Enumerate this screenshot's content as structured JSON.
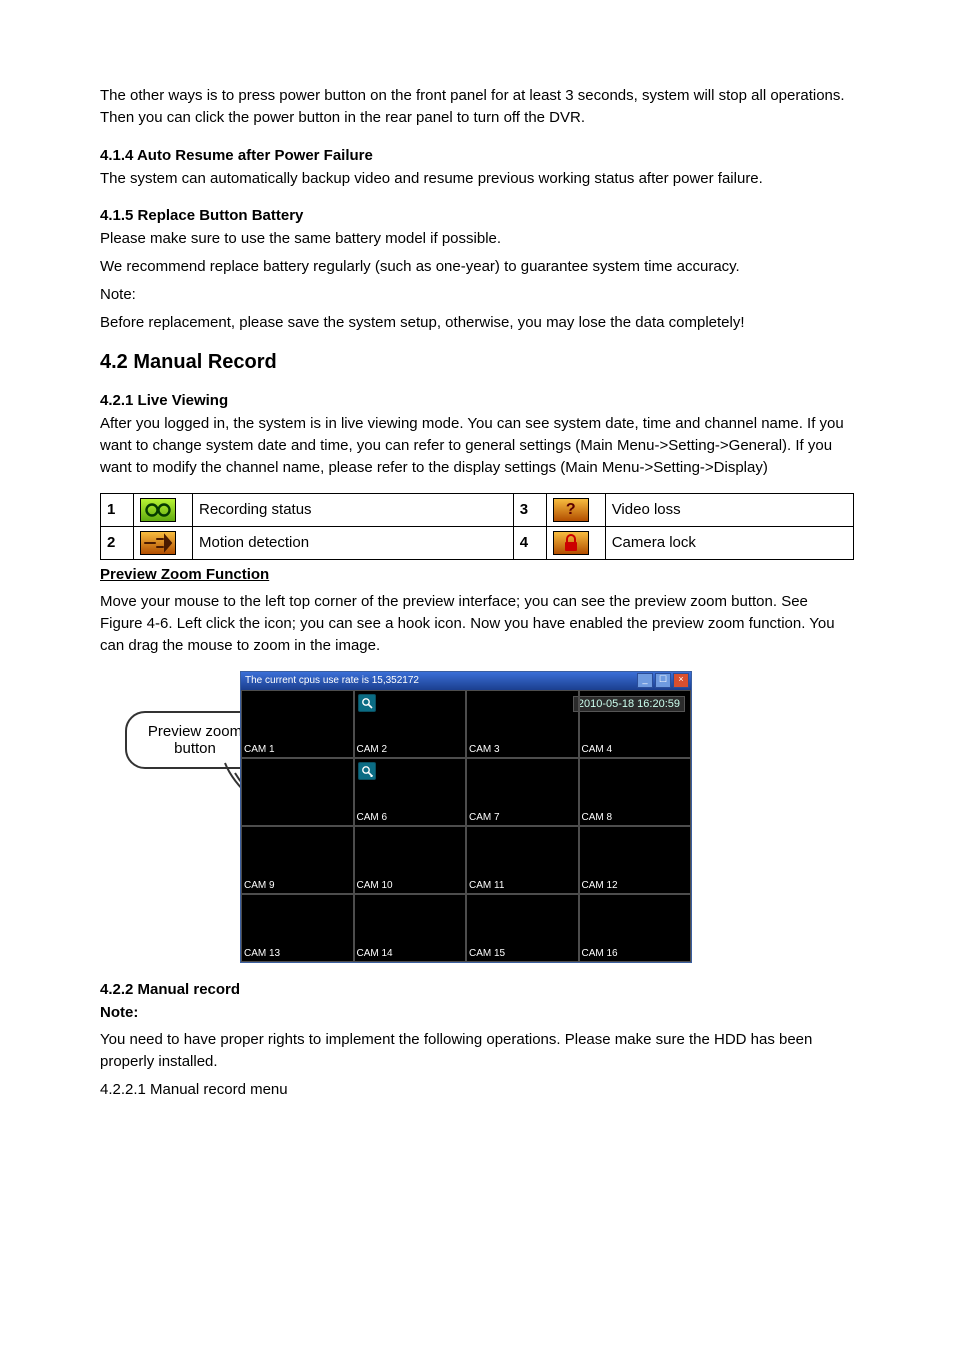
{
  "intro_para": "The other ways is to press power button on the front panel for at least 3 seconds, system will stop all operations. Then you can click the power button in the rear panel to turn off the DVR.",
  "s414": {
    "heading": "4.1.4   Auto Resume after Power Failure",
    "body": "The system can automatically backup video and resume previous working status after power failure."
  },
  "s415": {
    "heading": "4.1.5  Replace Button Battery",
    "p1": "Please make sure to use the same battery model if possible.",
    "p2": "We recommend replace battery regularly (such as one-year) to guarantee system time accuracy.",
    "note_label": "Note:",
    "note_body": "Before replacement, please save the system setup, otherwise, you may lose the data completely!"
  },
  "s42": {
    "heading": "4.2  Manual Record"
  },
  "s421": {
    "heading": "4.2.1   Live Viewing",
    "body": "After you logged in, the system is in live viewing mode. You can see system date, time and channel name. If you want to change system date and time, you can refer to general settings (Main Menu->Setting->General). If you want to modify the channel name, please refer to the display settings (Main Menu->Setting->Display)"
  },
  "status_table": {
    "rows": [
      {
        "n": "1",
        "icon": "recording-icon",
        "desc": "Recording status",
        "n2": "3",
        "icon2": "videoloss-icon",
        "desc2": "Video loss"
      },
      {
        "n": "2",
        "icon": "motion-icon",
        "desc": "Motion detection",
        "n2": "4",
        "icon2": "lock-icon",
        "desc2": "Camera lock"
      }
    ]
  },
  "preview_zoom": {
    "heading": "Preview Zoom Function",
    "body": "Move your mouse to the left top corner of the preview interface; you can see the preview zoom button. See Figure 4-6. Left click the icon; you can see a hook icon. Now you have enabled the preview zoom function. You can drag the mouse to zoom in the image."
  },
  "callout_label": "Preview zoom button",
  "screenshot": {
    "title": "The current cpus use rate is  15,352172",
    "timestamp": "2010-05-18 16:20:59",
    "cams": [
      "CAM 1",
      "CAM 2",
      "CAM 3",
      "CAM 4",
      "",
      "CAM 6",
      "CAM 7",
      "CAM 8",
      "CAM 9",
      "CAM 10",
      "CAM 11",
      "CAM 12",
      "CAM 13",
      "CAM 14",
      "CAM 15",
      "CAM 16"
    ]
  },
  "s422": {
    "heading": "4.2.2   Manual record",
    "note_label": "Note:",
    "note_body": "You need to have proper rights to implement the following operations. Please make sure the HDD has been properly installed.",
    "sub": "4.2.2.1  Manual record menu"
  }
}
